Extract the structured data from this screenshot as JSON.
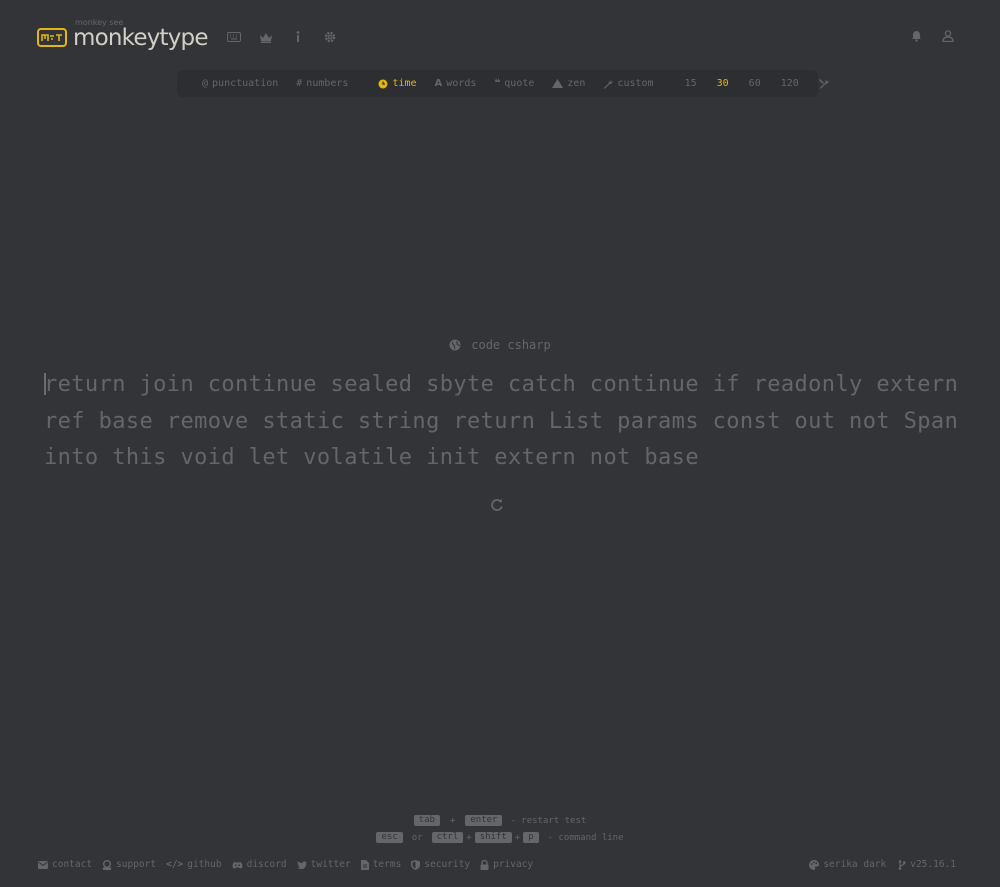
{
  "header": {
    "logo_sub": "monkey see",
    "logo_title": "monkeytype",
    "logo_icon": "keyboard-logo-icon",
    "nav": [
      "keyboard-icon",
      "crown-icon",
      "info-icon",
      "gear-icon"
    ],
    "right": [
      "bell-icon",
      "user-icon"
    ]
  },
  "config": {
    "punctuation": "punctuation",
    "numbers": "numbers",
    "time": "time",
    "words": "words",
    "quote": "quote",
    "zen": "zen",
    "custom": "custom",
    "durations": [
      "15",
      "30",
      "60",
      "120"
    ],
    "active_mode": "time",
    "active_duration": "30"
  },
  "test": {
    "language": "code csharp",
    "words": "return join continue sealed sbyte catch continue if readonly extern ref base remove static string return List params const out not Span into this void let volatile init extern not base"
  },
  "hints": {
    "key_tab": "tab",
    "plus1": "+",
    "key_enter": "enter",
    "restart_label": "- restart test",
    "key_esc": "esc",
    "or": "or",
    "key_ctrl": "ctrl",
    "plus2": "+",
    "key_shift": "shift",
    "plus3": "+",
    "key_p": "p",
    "command_label": "- command line"
  },
  "footer": {
    "contact": "contact",
    "support": "support",
    "github": "github",
    "discord": "discord",
    "twitter": "twitter",
    "terms": "terms",
    "security": "security",
    "privacy": "privacy",
    "theme": "serika dark",
    "version": "v25.16.1"
  },
  "colors": {
    "background": "#323437",
    "sub": "#646669",
    "main": "#e2b714",
    "text": "#d1d0c5"
  }
}
